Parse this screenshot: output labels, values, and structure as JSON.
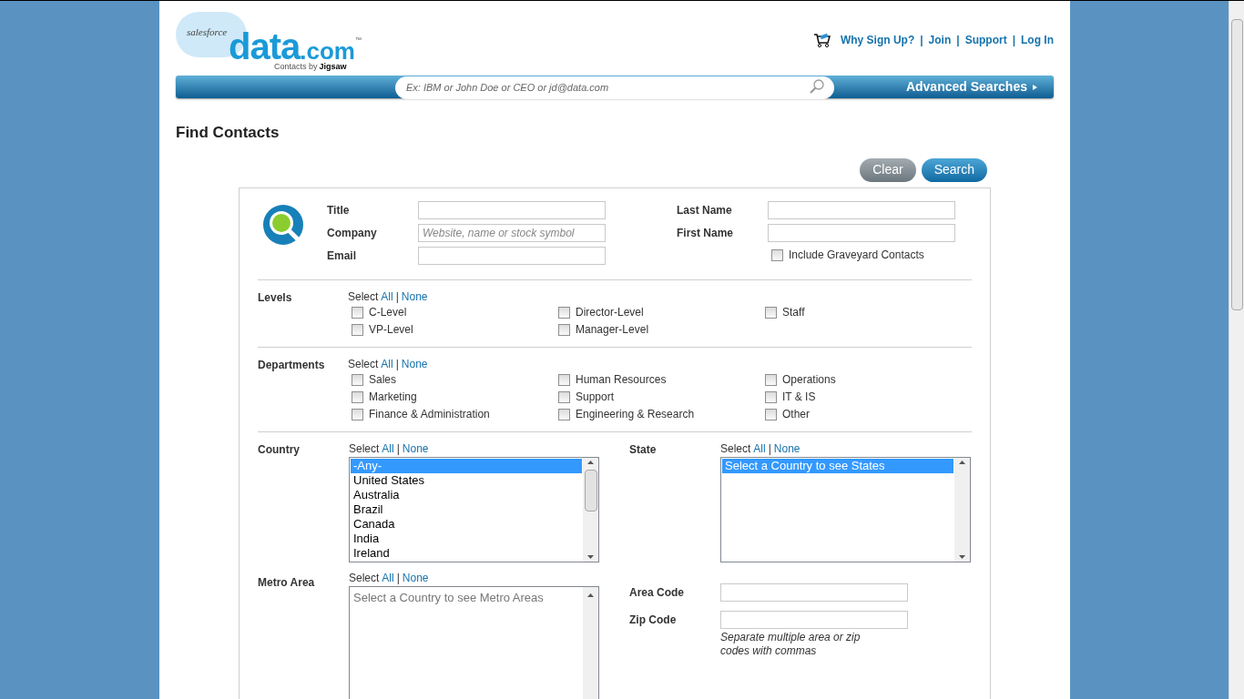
{
  "logo": {
    "brand_small": "salesforce",
    "brand": "data",
    "brand_suffix": ".com",
    "tm": "™",
    "tagline_prefix": "Contacts by",
    "tagline_brand": "Jigsaw"
  },
  "top_links": {
    "separator": "|",
    "items": [
      "Why Sign Up?",
      "Join",
      "Support",
      "Log In"
    ]
  },
  "search_bar": {
    "placeholder": "Ex: IBM or John Doe or CEO or jd@data.com",
    "advanced": "Advanced Searches"
  },
  "page_title": "Find Contacts",
  "buttons": [
    {
      "label": "Clear",
      "kind": "secondary"
    },
    {
      "label": "Search",
      "kind": "primary"
    }
  ],
  "fields_left": [
    {
      "label": "Title"
    },
    {
      "label": "Company",
      "placeholder": "Website, name or stock symbol"
    },
    {
      "label": "Email"
    }
  ],
  "fields_right": [
    {
      "label": "Last Name"
    },
    {
      "label": "First Name"
    }
  ],
  "graveyard": {
    "label": "Include Graveyard Contacts",
    "checked": false
  },
  "groups": [
    {
      "label": "Levels",
      "select_links": {
        "select": "Select",
        "all": "All",
        "separator": "|",
        "none": "None"
      },
      "columns": [
        [
          {
            "label": "C-Level",
            "checked": false
          },
          {
            "label": "VP-Level",
            "checked": false
          }
        ],
        [
          {
            "label": "Director-Level",
            "checked": false
          },
          {
            "label": "Manager-Level",
            "checked": false
          }
        ],
        [
          {
            "label": "Staff",
            "checked": false
          }
        ]
      ]
    },
    {
      "label": "Departments",
      "select_links": {
        "select": "Select",
        "all": "All",
        "separator": "|",
        "none": "None"
      },
      "columns": [
        [
          {
            "label": "Sales",
            "checked": false
          },
          {
            "label": "Marketing",
            "checked": false
          },
          {
            "label": "Finance & Administration",
            "checked": false
          }
        ],
        [
          {
            "label": "Human Resources",
            "checked": false
          },
          {
            "label": "Support",
            "checked": false
          },
          {
            "label": "Engineering & Research",
            "checked": false
          }
        ],
        [
          {
            "label": "Operations",
            "checked": false
          },
          {
            "label": "IT & IS",
            "checked": false
          },
          {
            "label": "Other",
            "checked": false
          }
        ]
      ]
    }
  ],
  "country": {
    "label": "Country",
    "select_links": {
      "select": "Select",
      "all": "All",
      "separator": "|",
      "none": "None"
    },
    "options": [
      {
        "label": "-Any-",
        "selected": true
      },
      {
        "label": "United States",
        "selected": false
      },
      {
        "label": "Australia",
        "selected": false
      },
      {
        "label": "Brazil",
        "selected": false
      },
      {
        "label": "Canada",
        "selected": false
      },
      {
        "label": "India",
        "selected": false
      },
      {
        "label": "Ireland",
        "selected": false
      }
    ]
  },
  "state": {
    "label": "State",
    "select_links": {
      "select": "Select",
      "all": "All",
      "separator": "|",
      "none": "None"
    },
    "options": [
      {
        "label": "Select a Country to see States",
        "selected": true
      }
    ]
  },
  "metro_area": {
    "label": "Metro Area",
    "select_links": {
      "select": "Select",
      "all": "All",
      "separator": "|",
      "none": "None"
    },
    "placeholder": "Select a Country to see Metro Areas"
  },
  "area_code": {
    "label": "Area Code"
  },
  "zip_code": {
    "label": "Zip Code",
    "hint": "Separate multiple area or zip codes with commas"
  }
}
